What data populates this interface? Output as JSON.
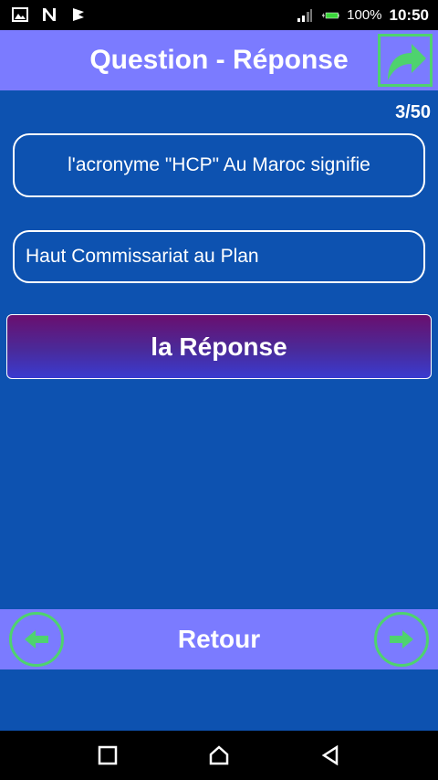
{
  "status_bar": {
    "battery": "100%",
    "time": "10:50"
  },
  "header": {
    "title": "Question - Réponse"
  },
  "counter": "3/50",
  "question": "l'acronyme \"HCP\" Au Maroc signifie",
  "answer": "Haut Commissariat au Plan",
  "reveal_button": "la Réponse",
  "footer": {
    "back_label": "Retour"
  },
  "colors": {
    "background": "#0d52b0",
    "bar": "#7b7bff",
    "accent": "#4ed36e"
  }
}
